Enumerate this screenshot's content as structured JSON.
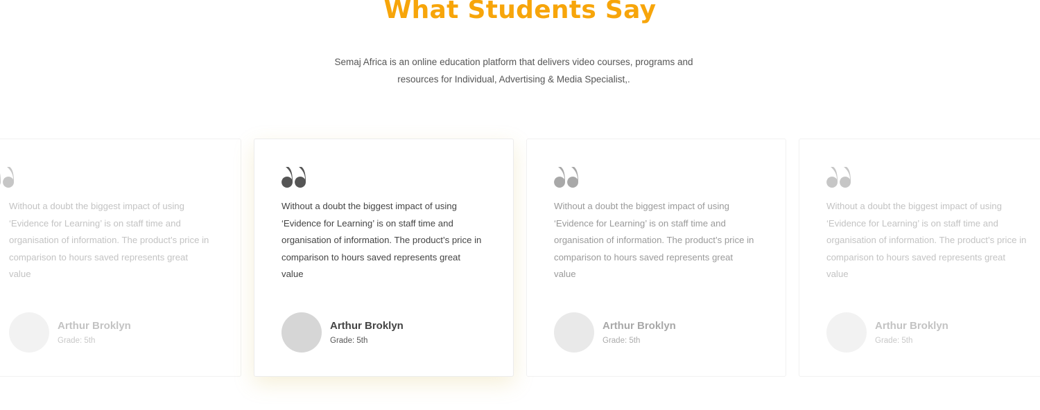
{
  "section": {
    "title": "What Students Say",
    "intro_line1": "Semaj Africa is an online education platform that delivers video courses, programs and",
    "intro_line2": "resources for Individual, Advertising & Media Specialist,."
  },
  "testimonials": [
    {
      "quote": "Without a doubt the biggest impact of using ‘Evidence for Learning’ is on staff time and organisation of information. The product’s price in comparison to hours saved represents great value",
      "name": "Arthur Broklyn",
      "grade": "Grade: 5th",
      "icon": "quote-icon"
    },
    {
      "quote": "Without a doubt the biggest impact of using ‘Evidence for Learning’ is on staff time and organisation of information. The product’s price in comparison to hours saved represents great value",
      "name": "Arthur Broklyn",
      "grade": "Grade: 5th",
      "icon": "quote-icon"
    },
    {
      "quote": "Without a doubt the biggest impact of using ‘Evidence for Learning’ is on staff time and organisation of information. The product’s price in comparison to hours saved represents great value",
      "name": "Arthur Broklyn",
      "grade": "Grade: 5th",
      "icon": "quote-icon"
    },
    {
      "quote": "Without a doubt the biggest impact of using ‘Evidence for Learning’ is on staff time and organisation of information. The product’s price in comparison to hours saved represents great value",
      "name": "Arthur Broklyn",
      "grade": "Grade: 5th",
      "icon": "quote-icon"
    }
  ],
  "colors": {
    "accent": "#f7a50a",
    "text": "#555555"
  }
}
